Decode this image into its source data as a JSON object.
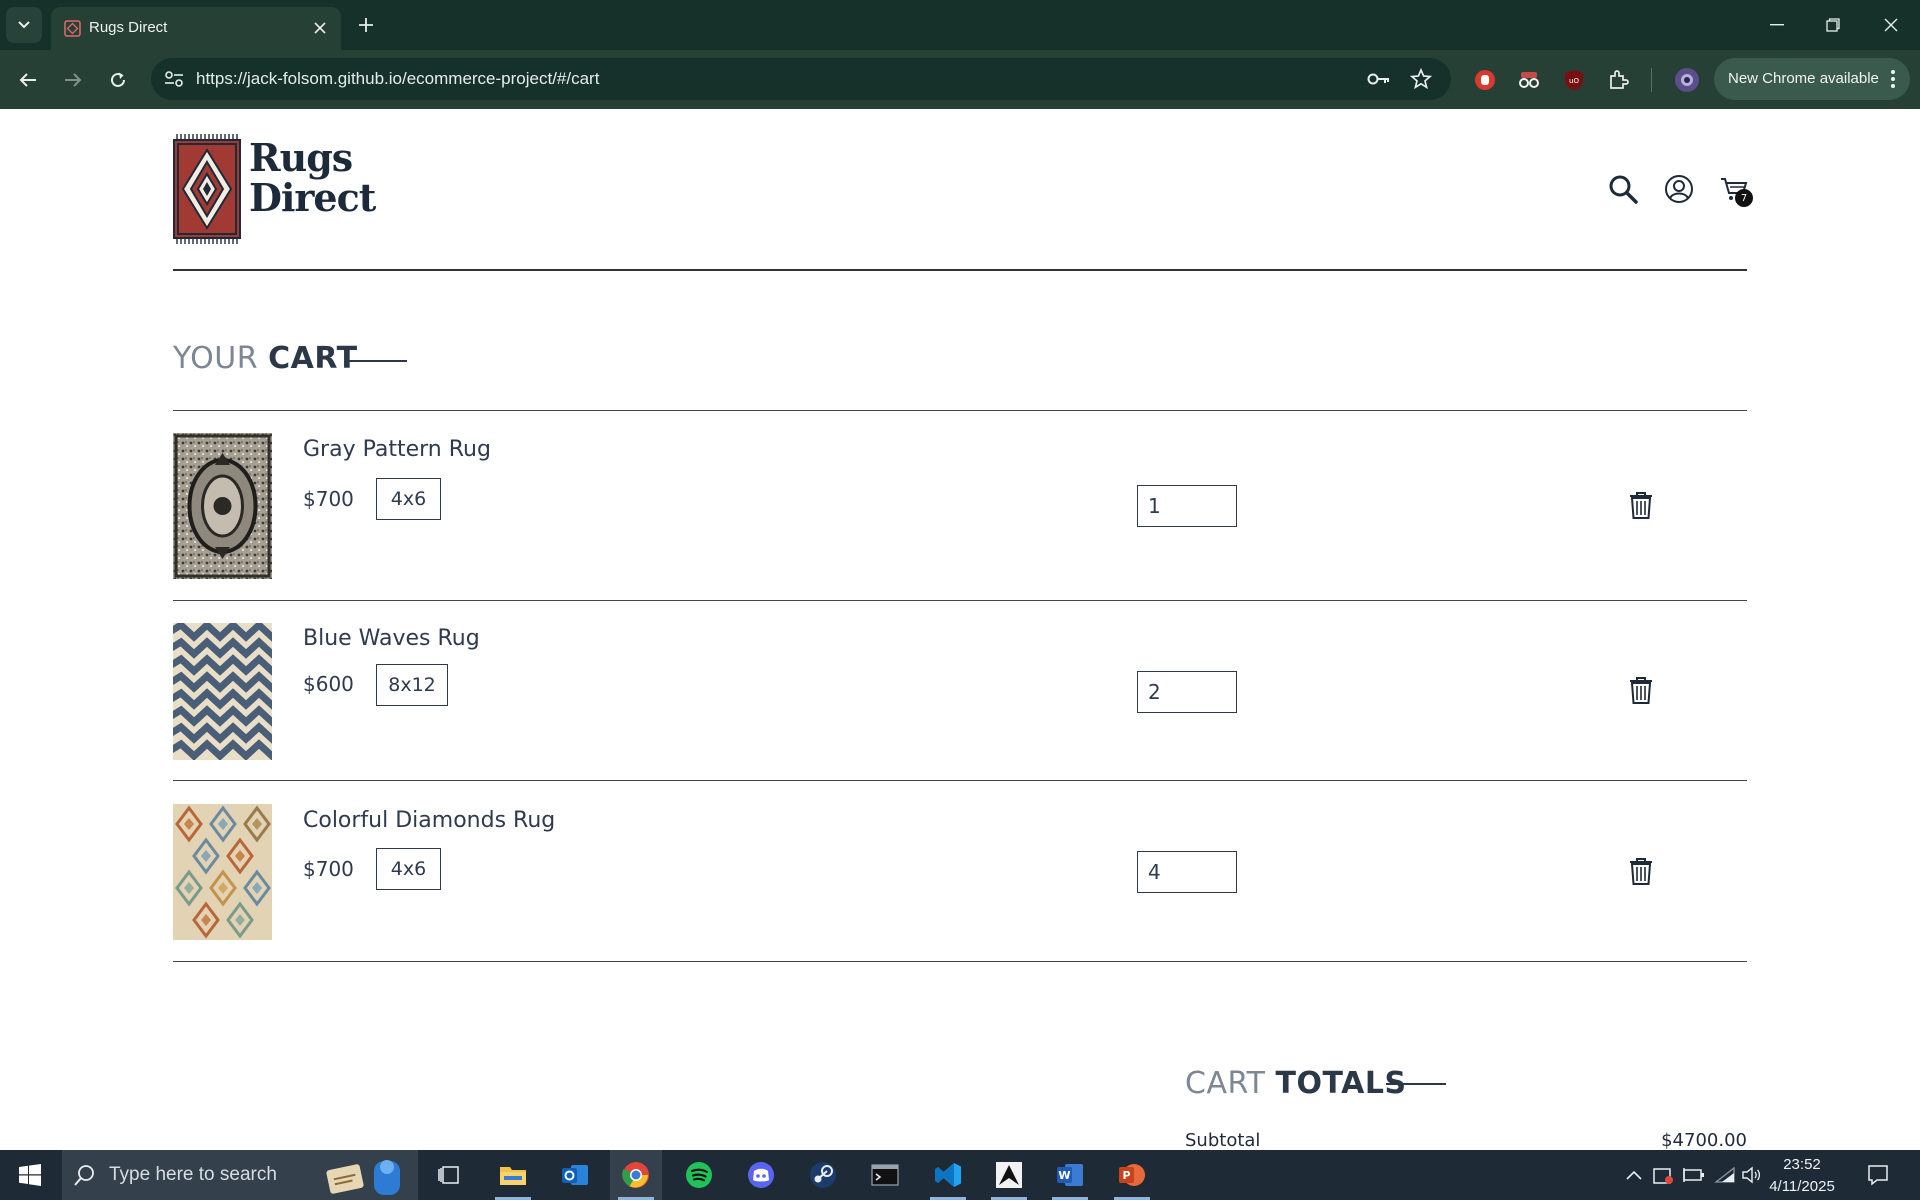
{
  "browser": {
    "tab_title": "Rugs Direct",
    "url": "https://jack-folsom.github.io/ecommerce-project/#/cart",
    "update_label": "New Chrome available"
  },
  "header": {
    "logo_line1": "Rugs",
    "logo_line2": "Direct",
    "cart_count": "7"
  },
  "cart": {
    "title_light": "YOUR",
    "title_bold": "CART",
    "items": [
      {
        "name": "Gray Pattern Rug",
        "price": "$700",
        "size": "4x6",
        "quantity": "1",
        "image": "gray-pattern-rug"
      },
      {
        "name": "Blue Waves Rug",
        "price": "$600",
        "size": "8x12",
        "quantity": "2",
        "image": "blue-waves-rug"
      },
      {
        "name": "Colorful Diamonds Rug",
        "price": "$700",
        "size": "4x6",
        "quantity": "4",
        "image": "colorful-diamonds-rug"
      }
    ]
  },
  "totals": {
    "title_light": "CART",
    "title_bold": "TOTALS",
    "subtotal_label": "Subtotal",
    "subtotal_value": "$4700.00"
  },
  "taskbar": {
    "search_placeholder": "Type here to search",
    "time": "23:52",
    "date": "4/11/2025"
  },
  "colors": {
    "chrome_dark": "#16302a",
    "chrome_toolbar": "#274036",
    "text_navy": "#2e3a4d",
    "rug_red": "#a23a34"
  }
}
